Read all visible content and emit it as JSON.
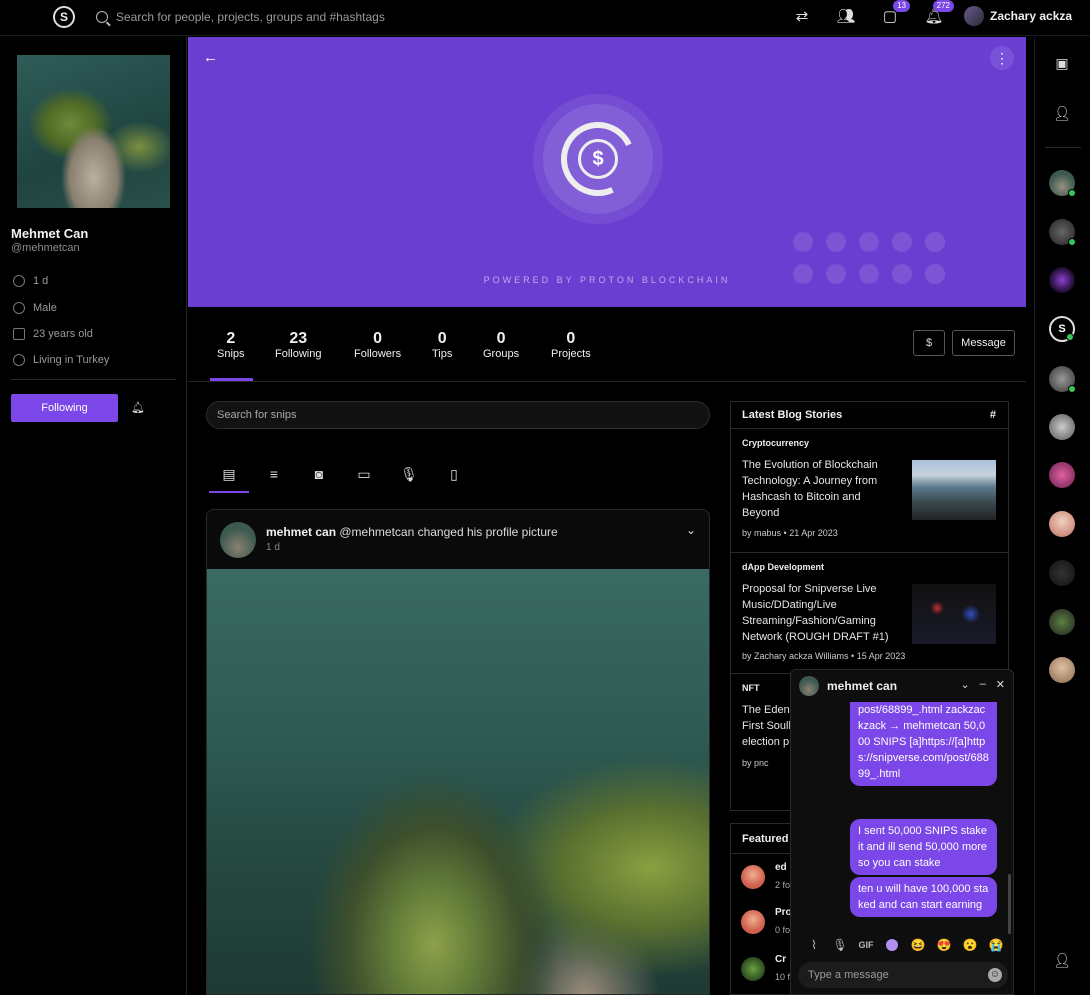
{
  "topbar": {
    "search_placeholder": "Search for people, projects, groups and #hashtags",
    "messages_badge": "13",
    "notifications_badge": "272",
    "user_name": "Zachary ackza"
  },
  "profile": {
    "name": "Mehmet Can",
    "handle": "@mehmetcan",
    "joined": "1 d",
    "gender": "Male",
    "age": "23 years old",
    "location": "Living in Turkey",
    "follow_label": "Following"
  },
  "hero": {
    "powered": "POWERED BY PROTON BLOCKCHAIN",
    "coin_symbol": "$"
  },
  "stats": [
    {
      "n": "2",
      "l": "Snips"
    },
    {
      "n": "23",
      "l": "Following"
    },
    {
      "n": "0",
      "l": "Followers"
    },
    {
      "n": "0",
      "l": "Tips"
    },
    {
      "n": "0",
      "l": "Groups"
    },
    {
      "n": "0",
      "l": "Projects"
    }
  ],
  "actions": {
    "message_label": "Message",
    "tip_symbol": "$"
  },
  "feed": {
    "search_placeholder": "Search for snips",
    "post": {
      "author": "mehmet can",
      "text": "@mehmetcan changed his profile picture",
      "time": "1 d"
    }
  },
  "blog": {
    "header": "Latest Blog Stories",
    "hash": "#",
    "stories": [
      {
        "category": "Cryptocurrency",
        "title": "The Evolution of Blockchain Technology: A Journey from Hashcash to Bitcoin and Beyond",
        "author": "by mabus",
        "date": "21 Apr 2023"
      },
      {
        "category": "dApp Development",
        "title": "Proposal for Snipverse Live Music/DDating/Live Streaming/Fashion/Gaming Network (ROUGH DRAFT #1)",
        "author": "by Zachary ackza Williams",
        "date": "15 Apr 2023"
      },
      {
        "category": "NFT",
        "title": "The Eden First Soull election p",
        "author": "by pnc",
        "date": ""
      }
    ]
  },
  "featured": {
    "header": "Featured",
    "items": [
      {
        "name": "ed",
        "sub": "2 fo"
      },
      {
        "name": "Pro",
        "sub": "0 fo"
      },
      {
        "name": "Cr",
        "sub": "10 f"
      }
    ]
  },
  "chat": {
    "name": "mehmet can",
    "messages": [
      "post/68899_.html zackzackzack → mehmetcan 50,000 SNIPS [a]https://[a]https://snipverse.com/post/68899_.html",
      "I sent 50,000 SNIPS stake it and ill send 50,000 more so you can stake",
      "ten u will have 100,000 staked and can start earning"
    ],
    "gif_label": "GIF",
    "input_placeholder": "Type a message"
  }
}
